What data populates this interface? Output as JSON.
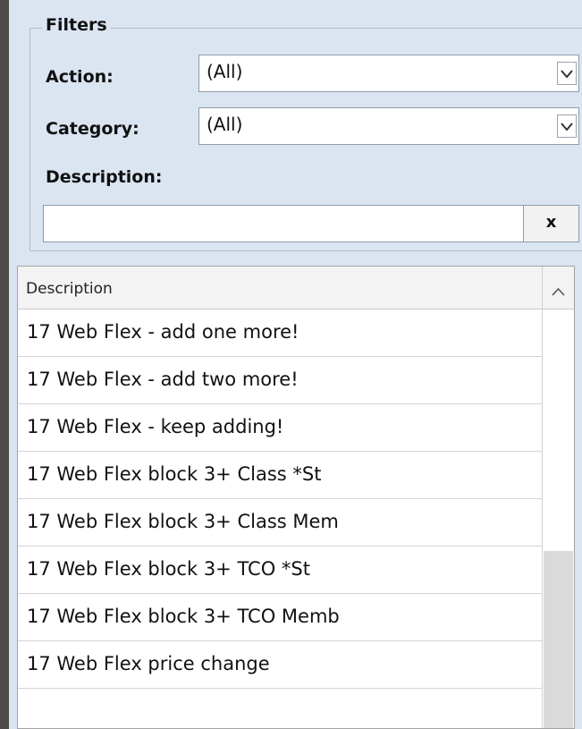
{
  "filters": {
    "legend": "Filters",
    "action_label": "Action:",
    "action_value": "(All)",
    "category_label": "Category:",
    "category_value": "(All)",
    "description_label": "Description:",
    "description_value": "",
    "clear_label": "x"
  },
  "grid": {
    "column_header": "Description",
    "rows": [
      "17 Web Flex - add one more!",
      "17 Web Flex - add two more!",
      "17 Web Flex - keep adding!",
      "17 Web Flex block 3+ Class *St",
      "17 Web Flex block 3+ Class Mem",
      "17 Web Flex block 3+ TCO *St",
      "17 Web Flex block 3+ TCO Memb",
      "17 Web Flex price change"
    ]
  },
  "icons": {
    "dropdown": "chevron-down-icon",
    "scroll_up": "chevron-up-icon"
  }
}
